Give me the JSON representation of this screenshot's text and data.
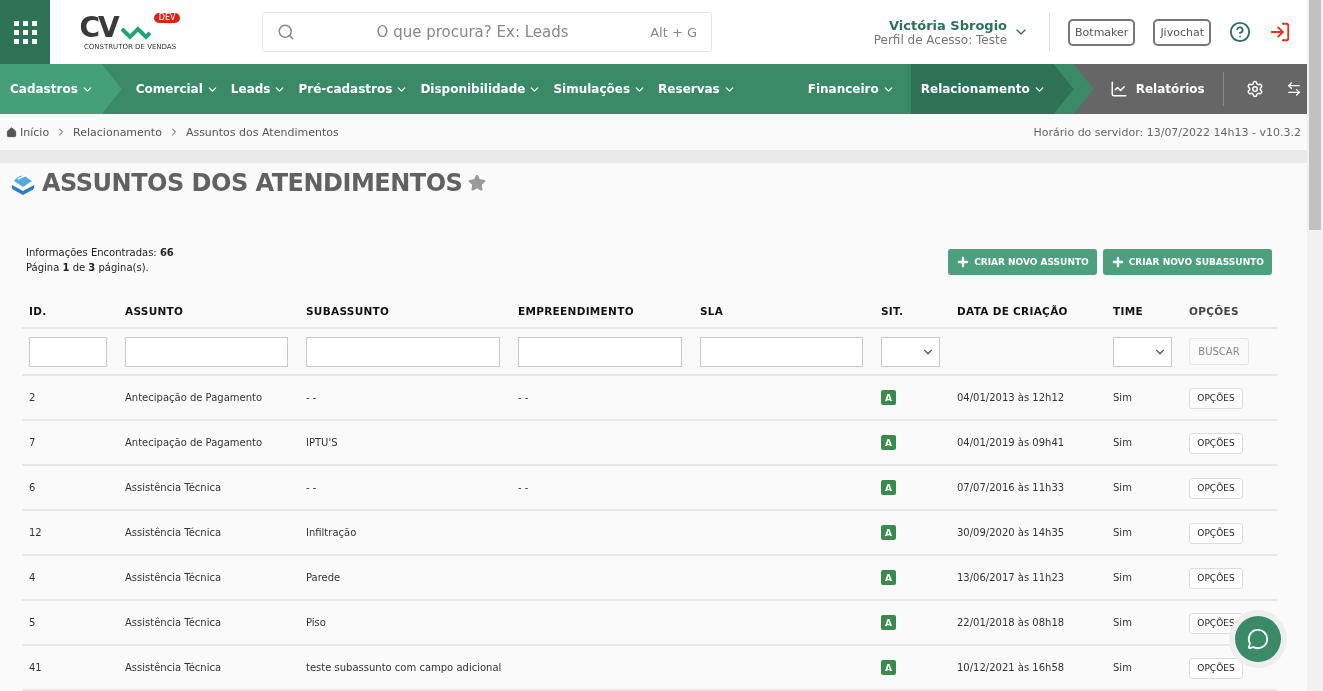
{
  "header": {
    "logo": {
      "text": "CV",
      "badge": "DEV",
      "tagline": "CONSTRUTOR DE VENDAS"
    },
    "search": {
      "placeholder": "O que procura? Ex: Leads",
      "shortcut": "Alt + G"
    },
    "user": {
      "name": "Victória Sbrogio",
      "profile": "Perfil de Acesso: Teste"
    },
    "buttons": [
      "Botmaker",
      "Jivochat"
    ]
  },
  "nav": {
    "items": [
      {
        "label": "Cadastros",
        "highlighted": true,
        "selected": false
      },
      {
        "label": "Comercial",
        "highlighted": false,
        "selected": false
      },
      {
        "label": "Leads",
        "highlighted": false,
        "selected": false
      },
      {
        "label": "Pré-cadastros",
        "highlighted": false,
        "selected": false
      },
      {
        "label": "Disponibilidade",
        "highlighted": false,
        "selected": false
      },
      {
        "label": "Simulações",
        "highlighted": false,
        "selected": false
      },
      {
        "label": "Reservas",
        "highlighted": false,
        "selected": false
      },
      {
        "label": "Financeiro",
        "highlighted": false,
        "selected": false
      },
      {
        "label": "Relacionamento",
        "highlighted": false,
        "selected": true
      }
    ],
    "reports": "Relatórios"
  },
  "breadcrumb": [
    "Início",
    "Relacionamento",
    "Assuntos dos Atendimentos"
  ],
  "server_time": "Horário do servidor: 13/07/2022 14h13 - v10.3.2",
  "page_title": "ASSUNTOS DOS ATENDIMENTOS",
  "info": {
    "found": "Informações Encontradas: **66**",
    "pages": "Página **1** de **3** página(s)."
  },
  "actions": [
    "CRIAR NOVO ASSUNTO",
    "CRIAR NOVO SUBASSUNTO"
  ],
  "table": {
    "columns": [
      "ID.",
      "ASSUNTO",
      "SUBASSUNTO",
      "EMPREENDIMENTO",
      "SLA",
      "SIT.",
      "DATA DE CRIAÇÃO",
      "TIME",
      "OPÇÕES"
    ],
    "filters": [
      {
        "kind": "text"
      },
      {
        "kind": "text"
      },
      {
        "kind": "text"
      },
      {
        "kind": "text"
      },
      {
        "kind": "text"
      },
      {
        "kind": "select"
      },
      {
        "kind": "none"
      },
      {
        "kind": "select"
      },
      {
        "kind": "button",
        "label": "BUSCAR"
      }
    ],
    "rows": [
      {
        "id": "2",
        "assunto": "Antecipação de Pagamento",
        "subassunto": "- -",
        "empreendimento": "- -",
        "sla": "",
        "sit": "A",
        "data": "04/01/2013 às 12h12",
        "time": "Sim",
        "option": "OPÇÕES"
      },
      {
        "id": "7",
        "assunto": "Antecipação de Pagamento",
        "subassunto": "IPTU'S",
        "empreendimento": "",
        "sla": "",
        "sit": "A",
        "data": "04/01/2019 às 09h41",
        "time": "Sim",
        "option": "OPÇÕES"
      },
      {
        "id": "6",
        "assunto": "Assistência Técnica",
        "subassunto": "- -",
        "empreendimento": "- -",
        "sla": "",
        "sit": "A",
        "data": "07/07/2016 às 11h33",
        "time": "Sim",
        "option": "OPÇÕES"
      },
      {
        "id": "12",
        "assunto": "Assistência Técnica",
        "subassunto": "Infiltração",
        "empreendimento": "",
        "sla": "",
        "sit": "A",
        "data": "30/09/2020 às 14h35",
        "time": "Sim",
        "option": "OPÇÕES"
      },
      {
        "id": "4",
        "assunto": "Assistência Técnica",
        "subassunto": "Parede",
        "empreendimento": "",
        "sla": "",
        "sit": "A",
        "data": "13/06/2017 às 11h23",
        "time": "Sim",
        "option": "OPÇÕES"
      },
      {
        "id": "5",
        "assunto": "Assistência Técnica",
        "subassunto": "Piso",
        "empreendimento": "",
        "sla": "",
        "sit": "A",
        "data": "22/01/2018 às 08h18",
        "time": "Sim",
        "option": "OPÇÕES"
      },
      {
        "id": "41",
        "assunto": "Assistência Técnica",
        "subassunto": "teste subassunto com campo adicional",
        "empreendimento": "",
        "sla": "",
        "sit": "A",
        "data": "10/12/2021 às 16h58",
        "time": "Sim",
        "option": "OPÇÕES"
      }
    ]
  }
}
